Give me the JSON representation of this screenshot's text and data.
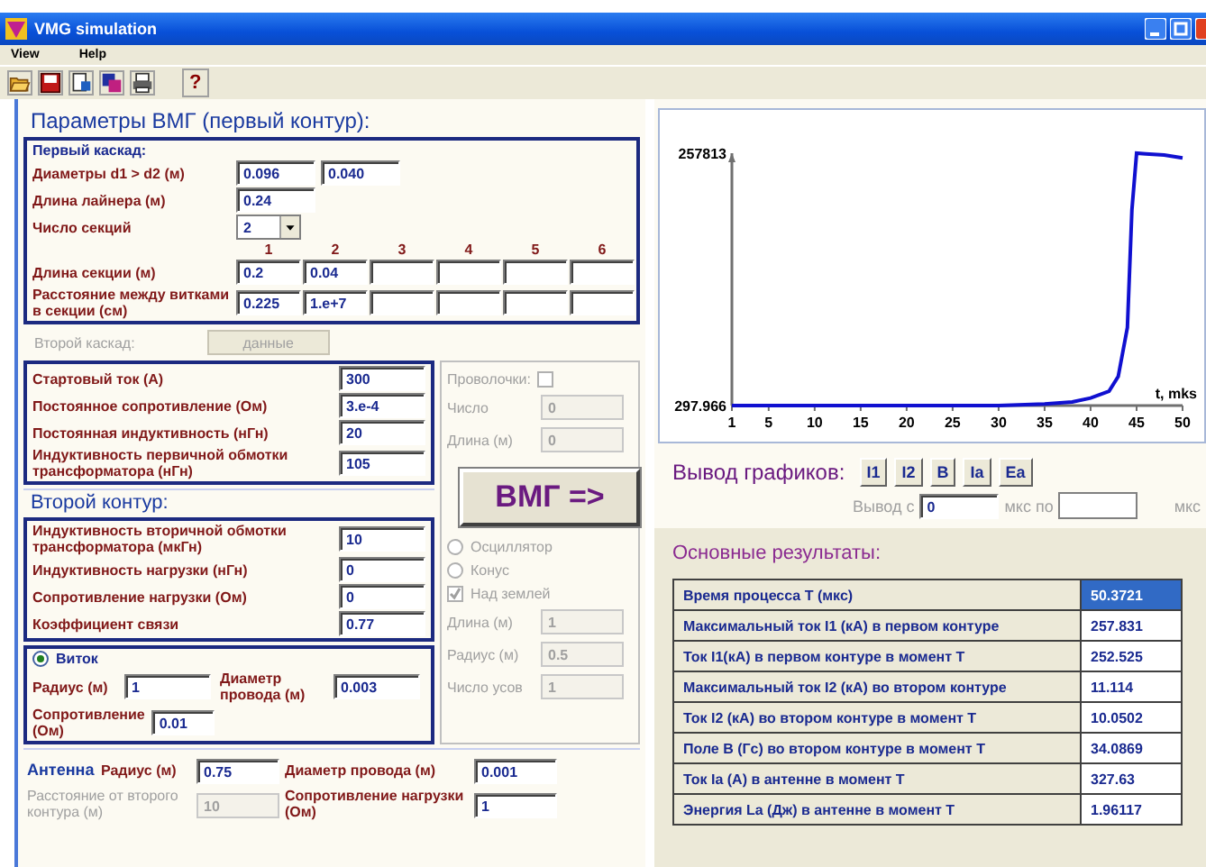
{
  "window": {
    "title": "VMG simulation"
  },
  "menu": [
    {
      "label": "View"
    },
    {
      "label": "Help"
    }
  ],
  "toolbar": {
    "help": "?"
  },
  "params": {
    "heading": "Параметры ВМГ (первый контур):",
    "first_cascade": {
      "title": "Первый каскад:",
      "diameters": {
        "label": "Диаметры d1 > d2 (м)",
        "values": [
          "0.096",
          "0.040"
        ]
      },
      "liner_length": {
        "label": "Длина лайнера (м)",
        "value": "0.24"
      },
      "sections": {
        "label": "Число секций",
        "value": "2"
      },
      "columns": [
        "1",
        "2",
        "3",
        "4",
        "5",
        "6"
      ],
      "section_length": {
        "label": "Длина секции (м)",
        "values": [
          "0.2",
          "0.04"
        ]
      },
      "turn_spacing": {
        "label": "Расстояние между витками в секции (см)",
        "values": [
          "0.225",
          "1.e+7"
        ]
      }
    },
    "second_cascade": {
      "label": "Второй каскад:",
      "button": "данные",
      "disabled": true
    },
    "primary": [
      {
        "label": "Стартовый ток (А)",
        "value": "300"
      },
      {
        "label": "Постоянное сопротивление (Ом)",
        "value": "3.e-4"
      },
      {
        "label": "Постоянная индуктивность (нГн)",
        "value": "20"
      },
      {
        "label": "Индуктивность первичной обмотки трансформатора (нГн)",
        "value": "105"
      }
    ],
    "wires": {
      "label": "Проволочки:",
      "checked": false,
      "disabled": true,
      "fields": [
        {
          "label": "Число",
          "value": "0"
        },
        {
          "label": "Длина (м)",
          "value": "0"
        }
      ]
    },
    "run_button": "ВМГ =>"
  },
  "second_circuit": {
    "heading": "Второй контур:",
    "fields": [
      {
        "label": "Индуктивность вторичной обмотки трансформатора (мкГн)",
        "value": "10"
      },
      {
        "label": "Индуктивность нагрузки (нГн)",
        "value": "0"
      },
      {
        "label": "Сопротивление нагрузки (Ом)",
        "value": "0"
      },
      {
        "label": "Коэффициент связи",
        "value": "0.77"
      }
    ],
    "turn": {
      "label": "Виток",
      "selected": true,
      "radius": {
        "label": "Радиус (м)",
        "value": "1"
      },
      "wire_diameter": {
        "label": "Диаметр провода (м)",
        "value": "0.003"
      },
      "resistance": {
        "label": "Сопротивление (Ом)",
        "value": "0.01"
      }
    },
    "options": {
      "disabled": true,
      "radios": [
        {
          "label": "Осциллятор",
          "selected": false
        },
        {
          "label": "Конус",
          "selected": false
        }
      ],
      "ground": {
        "label": "Над землей",
        "checked": true
      },
      "fields": [
        {
          "label": "Длина (м)",
          "value": "1"
        },
        {
          "label": "Радиус (м)",
          "value": "0.5"
        },
        {
          "label": "Число усов",
          "value": "1"
        }
      ]
    }
  },
  "antenna": {
    "title": "Антенна",
    "fields": [
      {
        "label": "Радиус (м)",
        "value": "0.75",
        "disabled": false
      },
      {
        "label": "Диаметр провода (м)",
        "value": "0.001",
        "disabled": false
      },
      {
        "label": "Расстояние от второго контура (м)",
        "value": "10",
        "disabled": true
      },
      {
        "label": "Сопротивление нагрузки (Ом)",
        "value": "1",
        "disabled": false
      }
    ]
  },
  "chart": {
    "chart_data": {
      "type": "line",
      "xlabel": "t, mks",
      "xlim": [
        1,
        50
      ],
      "ylim": [
        297.966,
        257813
      ],
      "xticks": [
        1,
        5,
        10,
        15,
        20,
        25,
        30,
        35,
        40,
        45,
        50
      ],
      "yticks": [
        297.966,
        257813
      ],
      "series": [
        {
          "color": "#1010d0",
          "x": [
            1,
            5,
            10,
            15,
            20,
            25,
            30,
            35,
            38,
            40,
            42,
            43,
            44,
            44.5,
            45,
            46,
            48,
            50
          ],
          "values": [
            298,
            298,
            298,
            298,
            298,
            298,
            298,
            2000,
            4000,
            8000,
            15000,
            30000,
            80000,
            200000,
            257813,
            257000,
            256000,
            253000
          ]
        }
      ]
    }
  },
  "plot_output": {
    "label": "Вывод графиков:",
    "buttons": [
      "I1",
      "I2",
      "B",
      "Ia",
      "Ea"
    ],
    "range": {
      "disabled": true,
      "from_label": "Вывод с",
      "from": "0",
      "to_label": "мкс по",
      "unit": "мкс"
    }
  },
  "results": {
    "heading": "Основные результаты:",
    "rows": [
      {
        "label": "Время процесса T (мкс)",
        "value": "50.3721",
        "selected": true
      },
      {
        "label": "Максимальный ток I1 (кА) в первом контуре",
        "value": "257.831",
        "selected": false
      },
      {
        "label": "Ток I1(кА) в первом контуре в момент T",
        "value": "252.525",
        "selected": false
      },
      {
        "label": "Максимальный ток I2 (кА) во втором контуре",
        "value": "11.114",
        "selected": false
      },
      {
        "label": "Ток I2 (кА) во втором контуре в момент T",
        "value": "10.0502",
        "selected": false
      },
      {
        "label": "Поле B (Гс) во втором контуре в момент T",
        "value": "34.0869",
        "selected": false
      },
      {
        "label": "Ток Ia (А) в антенне в момент T",
        "value": "327.63",
        "selected": false
      },
      {
        "label": "Энергия La (Дж) в антенне в момент T",
        "value": "1.96117",
        "selected": false
      }
    ]
  }
}
